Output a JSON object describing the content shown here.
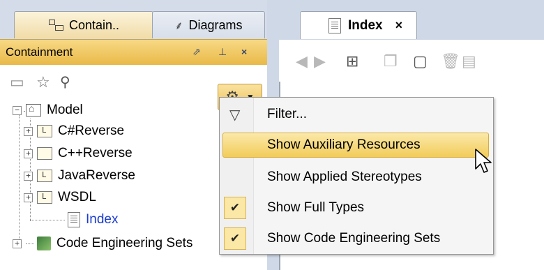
{
  "left_tabs": [
    {
      "label": "Contain..",
      "icon": "containment-tree-icon"
    },
    {
      "label": "Diagrams",
      "icon": "diagrams-icon"
    }
  ],
  "containment_panel": {
    "title": "Containment",
    "header_buttons": [
      "restore-icon",
      "pin-icon",
      "close-icon"
    ]
  },
  "toolbar_icons": [
    "open-folder-icon",
    "star-icon",
    "search-icon",
    "gear-icon",
    "chevron-down-icon"
  ],
  "tree": {
    "root": {
      "label": "Model"
    },
    "children": [
      {
        "label": "C#Reverse",
        "icon": "package-l-icon",
        "expandable": true
      },
      {
        "label": "C++Reverse",
        "icon": "package-icon",
        "expandable": true
      },
      {
        "label": "JavaReverse",
        "icon": "package-l-icon",
        "expandable": true
      },
      {
        "label": "WSDL",
        "icon": "package-l-icon",
        "expandable": true
      },
      {
        "label": "Index",
        "icon": "document-icon",
        "expandable": false,
        "selected": true
      }
    ],
    "sibling": {
      "label": "Code Engineering Sets"
    }
  },
  "editor_tab": {
    "label": "Index",
    "close": "×"
  },
  "editor_toolbar_icons": [
    "back-icon",
    "forward-icon",
    "tree-icon",
    "copy-icon",
    "paste-icon",
    "delete-icon",
    "more-icon"
  ],
  "menu": {
    "items": [
      {
        "label": "Filter...",
        "icon": "filter-icon",
        "checked": false,
        "highlighted": false
      },
      {
        "label": "Show Auxiliary Resources",
        "checked": false,
        "highlighted": true
      },
      {
        "label": "Show Applied Stereotypes",
        "checked": false,
        "highlighted": false
      },
      {
        "label": "Show Full Types",
        "checked": true,
        "highlighted": false
      },
      {
        "label": "Show Code Engineering Sets",
        "checked": true,
        "highlighted": false
      }
    ],
    "checkmark": "✔"
  },
  "colors": {
    "header_gold": "#e9b947",
    "highlight": "#f2cc5a",
    "selected_text": "#1a3cd0"
  }
}
